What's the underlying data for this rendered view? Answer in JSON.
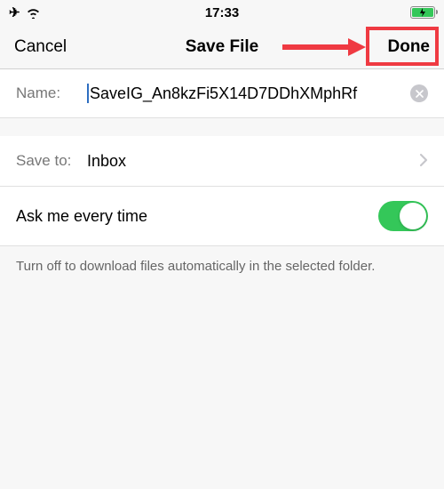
{
  "status": {
    "time": "17:33"
  },
  "header": {
    "cancel": "Cancel",
    "title": "Save File",
    "done": "Done"
  },
  "name_row": {
    "label": "Name:",
    "value": "SaveIG_An8kzFi5X14D7DDhXMphRf"
  },
  "saveto_row": {
    "label": "Save to:",
    "value": "Inbox"
  },
  "toggle_row": {
    "label": "Ask me every time"
  },
  "footer": {
    "text": "Turn off to download files automatically in the selected folder."
  }
}
